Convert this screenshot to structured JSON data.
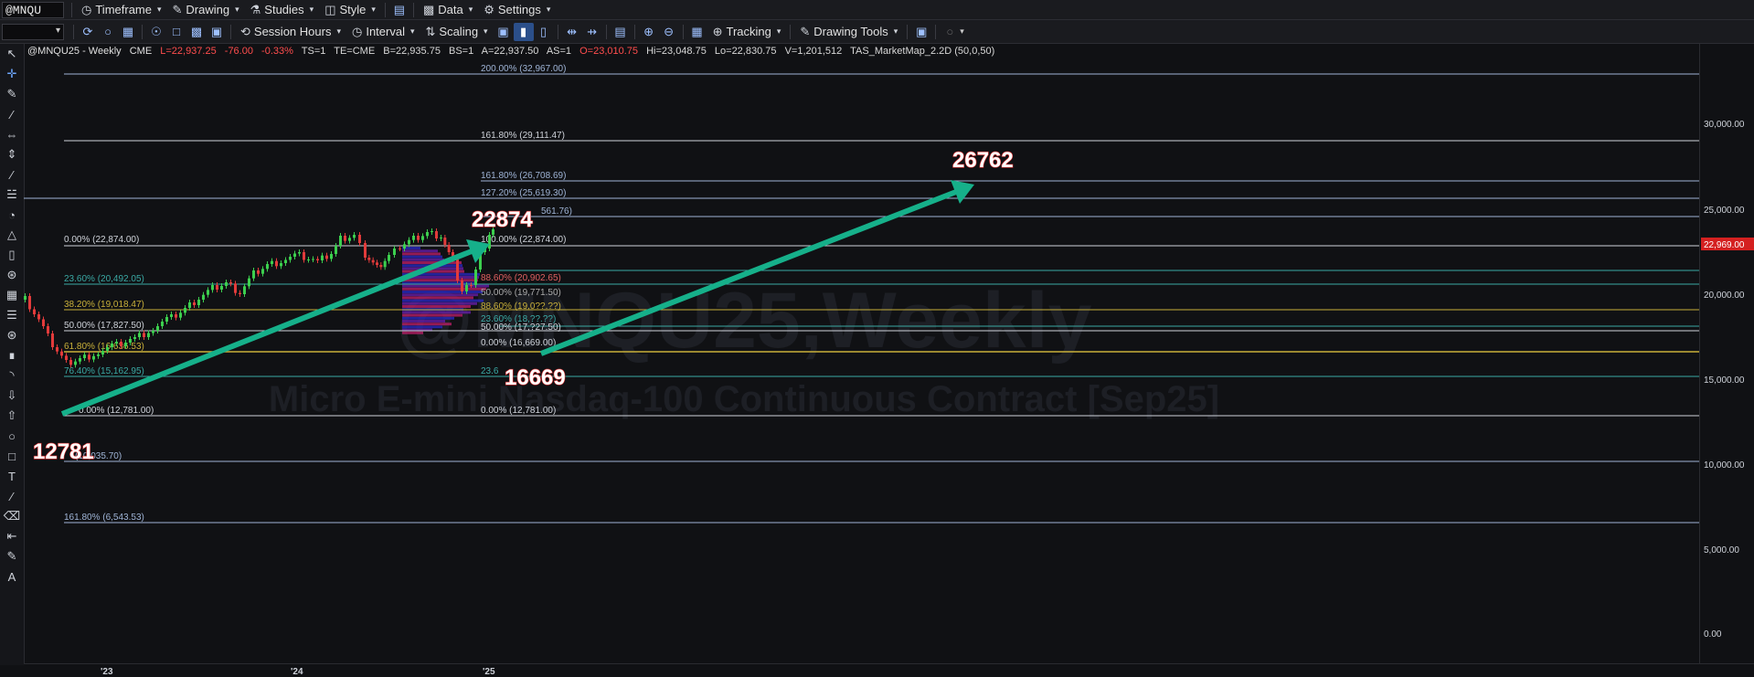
{
  "toolbar1": {
    "symbol": "@MNQU",
    "timeframe": "Timeframe",
    "drawing": "Drawing",
    "studies": "Studies",
    "style": "Style",
    "data": "Data",
    "settings": "Settings"
  },
  "toolbar2": {
    "session_hours": "Session Hours",
    "interval": "Interval",
    "scaling": "Scaling",
    "tracking": "Tracking",
    "drawing_tools": "Drawing Tools"
  },
  "info": {
    "symbol": "@MNQU25 - Weekly",
    "exchange": "CME",
    "last": "L=22,937.25",
    "change": "-76.00",
    "pct": "-0.33%",
    "ts": "TS=1",
    "te": "TE=CME",
    "bid": "B=22,935.75",
    "bs": "BS=1",
    "ask": "A=22,937.50",
    "as": "AS=1",
    "open": "O=23,010.75",
    "hi": "Hi=23,048.75",
    "lo": "Lo=22,830.75",
    "vol": "V=1,201,512",
    "study": "TAS_MarketMap_2.2D (50,0,50)"
  },
  "watermark": {
    "title": "@MNQU25,Weekly",
    "subtitle": "Micro E-mini Nasdaq-100 Continuous Contract [Sep25]"
  },
  "price_axis": {
    "labels": [
      "30,000.00",
      "25,000.00",
      "20,000.00",
      "15,000.00",
      "10,000.00",
      "5,000.00",
      "0.00"
    ],
    "current_price": "22,969.00"
  },
  "time_axis": {
    "labels": [
      "'23",
      "'24",
      "'25"
    ]
  },
  "fib_levels": [
    {
      "label": "200.00% (32,967.00)",
      "price": 32967
    },
    {
      "label": "161.80% (29,111.47)",
      "price": 29111.47
    },
    {
      "label": "161.80% (26,708.69)",
      "price": 26708.69
    },
    {
      "label": "127.20% (25,619.30)",
      "price": 25619.3
    },
    {
      "label": "561.76)",
      "price": 24561.76
    },
    {
      "label": "0.00% (22,874.00)",
      "price": 22874
    },
    {
      "label": "100.00% (22,874.00)",
      "price": 22874
    },
    {
      "label": "23.60% (20,492.05)",
      "price": 20492.05
    },
    {
      "label": "38.20% (19,018.47)",
      "price": 19018.47
    },
    {
      "label": "50.00% (17,827.50)",
      "price": 17827.5
    },
    {
      "label": "61.80% (16,636.53)",
      "price": 16636.53
    },
    {
      "label": "76.40% (15,162.95)",
      "price": 15162.95
    },
    {
      "label": "0.00% (12,781.00)",
      "price": 12781
    },
    {
      "label": "0.00% (12,781.00)",
      "price": 12781
    },
    {
      "label": "(10,035.70)",
      "price": 10035.7
    },
    {
      "label": "161.80% (6,543.53)",
      "price": 6543.53
    }
  ],
  "inner_fib_labels": [
    "88.60% (20,902.65)",
    "50.00% (19,771.50)",
    "88.60% (19,0??.??)",
    "23.60% (18,??.??)",
    "50.00% (17,?27.50)",
    "0.00% (16,669.00)",
    "23.6"
  ],
  "annotations": {
    "a12781": "12781",
    "a22874": "22874",
    "a16669": "16669",
    "a26762": "26762"
  },
  "colors": {
    "bg": "#101114",
    "toolbar": "#1a1b1f",
    "up": "#3ccf4e",
    "down": "#e23b3b",
    "arrow": "#16b08a",
    "fib_white": "#cfd3da",
    "fib_blue": "#9fb4d6",
    "fib_yellow": "#c9b03a",
    "fib_teal": "#3aa9a4",
    "price_tag": "#d42020"
  }
}
